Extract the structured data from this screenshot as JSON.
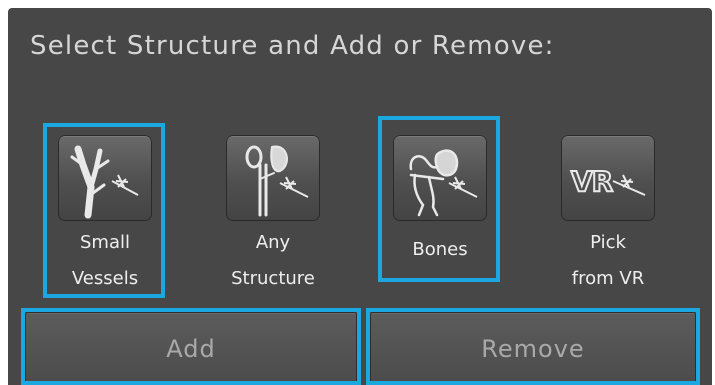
{
  "panel": {
    "title": "Select Structure and Add or Remove:"
  },
  "tools": [
    {
      "id": "small-vessels",
      "label_line1": "Small",
      "label_line2": "Vessels",
      "icon": "vessel-tree-icon",
      "selected": true
    },
    {
      "id": "any-structure",
      "label_line1": "Any",
      "label_line2": "Structure",
      "icon": "kidney-structure-icon",
      "selected": false
    },
    {
      "id": "bones",
      "label_line1": "Bones",
      "label_line2": "",
      "icon": "pelvis-bone-icon",
      "selected": true
    },
    {
      "id": "pick-from-vr",
      "label_line1": "Pick",
      "label_line2": "from VR",
      "icon": "vr-pick-icon",
      "selected": false
    }
  ],
  "actions": {
    "add_label": "Add",
    "remove_label": "Remove"
  },
  "colors": {
    "panel_bg": "#474747",
    "highlight": "#1ba8e0",
    "label_text": "#eeeeee",
    "title_text": "#d6d6d6"
  }
}
